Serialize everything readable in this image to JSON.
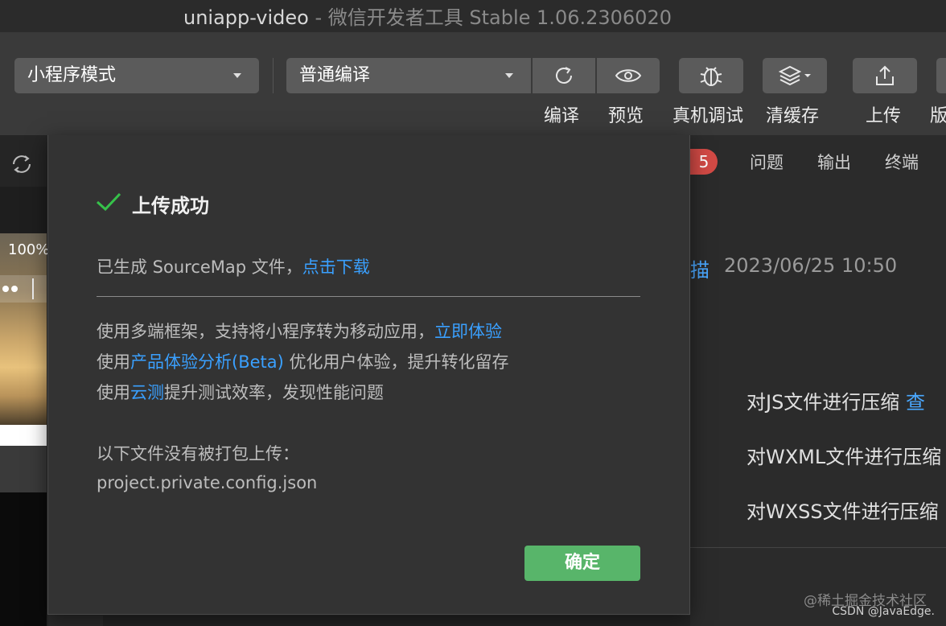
{
  "window": {
    "title_app": "uniapp-video",
    "title_sep": " - ",
    "title_tool": "微信开发者工具 Stable 1.06.2306020"
  },
  "toolbar": {
    "mode_select": "小程序模式",
    "compile_select": "普通编译",
    "compile_label": "编译",
    "preview_label": "预览",
    "debug_label": "真机调试",
    "cache_label": "清缓存",
    "upload_label": "上传",
    "version_label": "版"
  },
  "simulator": {
    "zoom": "100%"
  },
  "console": {
    "badge_count": "5",
    "tabs": [
      "问题",
      "输出",
      "终端"
    ],
    "scan_text": "描",
    "timestamp": "2023/06/25 10:50",
    "compress_items": [
      {
        "text": "对JS文件进行压缩 ",
        "link": "查"
      },
      {
        "text": "对WXML文件进行压缩"
      },
      {
        "text": "对WXSS文件进行压缩"
      }
    ]
  },
  "dialog": {
    "title": "上传成功",
    "sourcemap_prefix": "已生成 SourceMap 文件，",
    "sourcemap_link": "点击下载",
    "promo1_text": "使用多端框架，支持将小程序转为移动应用，",
    "promo1_link": "立即体验",
    "promo2_prefix": "使用",
    "promo2_link": "产品体验分析(Beta)",
    "promo2_suffix": " 优化用户体验，提升转化留存",
    "promo3_prefix": "使用",
    "promo3_link": "云测",
    "promo3_suffix": "提升测试效率，发现性能问题",
    "unpacked_heading": "以下文件没有被打包上传：",
    "unpacked_file": "project.private.config.json",
    "confirm_label": "确定"
  },
  "watermark": {
    "line1": "@稀土掘金技术社区",
    "line2": "CSDN @JavaEdge."
  },
  "colors": {
    "link": "#3aa0ff",
    "confirm": "#58b56a",
    "badge": "#d24a45",
    "success": "#36c24a"
  }
}
